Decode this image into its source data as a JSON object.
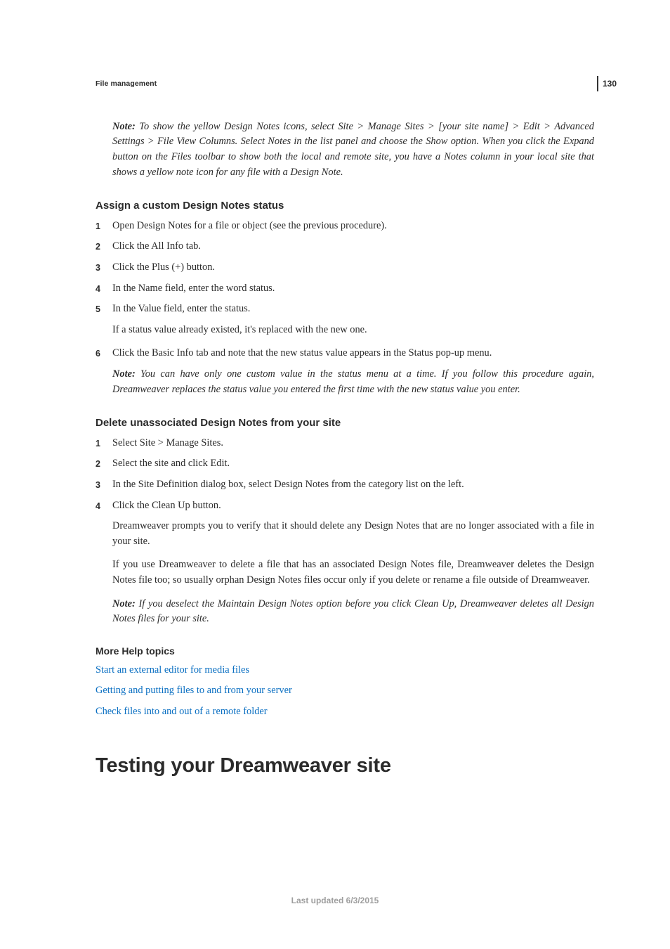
{
  "page_number": "130",
  "running_head": "File management",
  "intro_note": {
    "label": "Note:",
    "text": " To show the yellow Design Notes icons, select Site > Manage Sites > [your site name] > Edit > Advanced Settings > File View Columns. Select Notes in the list panel and choose the Show option. When you click the Expand button on the Files toolbar to show both the local and remote site, you have a Notes column in your local site that shows a yellow note icon for any file with a Design Note."
  },
  "section_a": {
    "heading": "Assign a custom Design Notes status",
    "steps": [
      "Open Design Notes for a file or object (see the previous procedure).",
      "Click the All Info tab.",
      "Click the Plus (+) button.",
      "In the Name field, enter the word status.",
      "In the Value field, enter the status."
    ],
    "step5_sub": "If a status value already existed, it's replaced with the new one.",
    "step6": "Click the Basic Info tab and note that the new status value appears in the Status pop-up menu.",
    "note": {
      "label": "Note:",
      "text": " You can have only one custom value in the status menu at a time. If you follow this procedure again, Dreamweaver replaces the status value you entered the first time with the new status value you enter."
    }
  },
  "section_b": {
    "heading": "Delete unassociated Design Notes from your site",
    "steps": [
      "Select Site > Manage Sites.",
      "Select the site and click Edit.",
      "In the Site Definition dialog box, select Design Notes from the category list on the left.",
      "Click the Clean Up button."
    ],
    "sub1": "Dreamweaver prompts you to verify that it should delete any Design Notes that are no longer associated with a file in your site.",
    "sub2": "If you use Dreamweaver to delete a file that has an associated Design Notes file, Dreamweaver deletes the Design Notes file too; so usually orphan Design Notes files occur only if you delete or rename a file outside of Dreamweaver.",
    "note": {
      "label": "Note:",
      "text": " If you deselect the Maintain Design Notes option before you click Clean Up, Dreamweaver deletes all Design Notes files for your site."
    }
  },
  "more_help": {
    "heading": "More Help topics",
    "links": [
      "Start an external editor for media files",
      "Getting and putting files to and from your server",
      "Check files into and out of a remote folder"
    ]
  },
  "page_title": "Testing your Dreamweaver site",
  "footer": "Last updated 6/3/2015"
}
